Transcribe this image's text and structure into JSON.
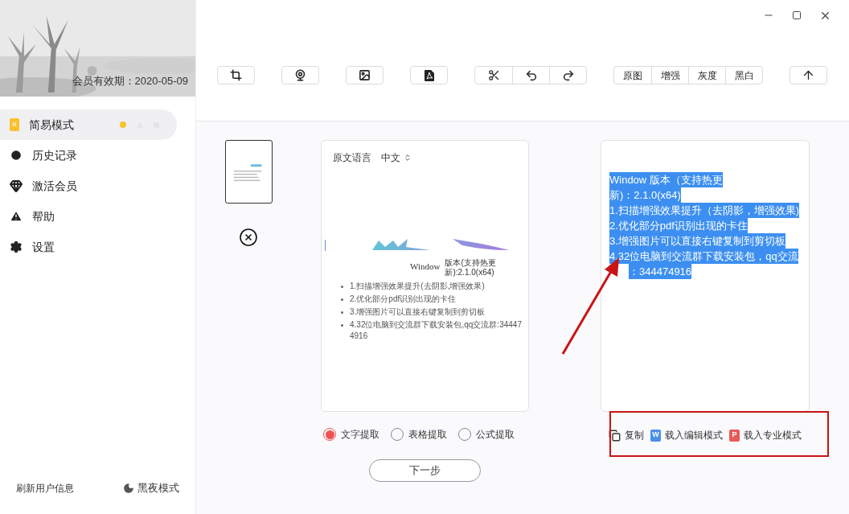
{
  "header": {
    "membership": "会员有效期：2020-05-09"
  },
  "sidebar": {
    "items": [
      {
        "label": "简易模式",
        "selected": true,
        "kind": "mode",
        "icon_letter": "B"
      },
      {
        "label": "历史记录",
        "selected": false,
        "kind": "history"
      },
      {
        "label": "激活会员",
        "selected": false,
        "kind": "member"
      },
      {
        "label": "帮助",
        "selected": false,
        "kind": "help"
      },
      {
        "label": "设置",
        "selected": false,
        "kind": "settings"
      }
    ]
  },
  "sidebar_footer": {
    "refresh": "刷新用户信息",
    "night_mode": "黑夜模式"
  },
  "toolbar": {
    "view_modes": [
      {
        "label": "原图"
      },
      {
        "label": "增强"
      },
      {
        "label": "灰度"
      },
      {
        "label": "黑白"
      }
    ]
  },
  "source_panel": {
    "language_label": "原文语言",
    "language": "中文",
    "document": {
      "title": "Window",
      "subtitle_lines": [
        "版本(支持热更",
        "新):2.1.0(x64)"
      ],
      "bullets": [
        "1.扫描增强效果提升(去阴影,增强效果)",
        "2.优化部分pdf识别出现的卡住",
        "3.增强图片可以直接右键复制到剪切板",
        "4.32位电脑到交流群下载安装包,qq交流群:344474916"
      ]
    }
  },
  "extraction_modes": [
    {
      "label": "文字提取",
      "selected": true
    },
    {
      "label": "表格提取",
      "selected": false
    },
    {
      "label": "公式提取",
      "selected": false
    }
  ],
  "next_button": "下一步",
  "result_panel": {
    "highlighted": true,
    "lines": [
      "Window 版本（支持热更",
      "新)：2.1.0(x64)",
      "1.扫描增强效果提升（去阴影，增强效果)",
      "2.优化部分pdf识别出现的卡住",
      "3.增强图片可以直接右键复制到剪切板",
      "4.32位电脑到交流群下载安装包，qq交流",
      "：344474916"
    ]
  },
  "actions": [
    {
      "label": "复制",
      "kind": "copy"
    },
    {
      "label": "载入编辑模式",
      "kind": "word",
      "icon_letter": "W"
    },
    {
      "label": "载入专业模式",
      "kind": "ppt",
      "icon_letter": "P"
    }
  ]
}
